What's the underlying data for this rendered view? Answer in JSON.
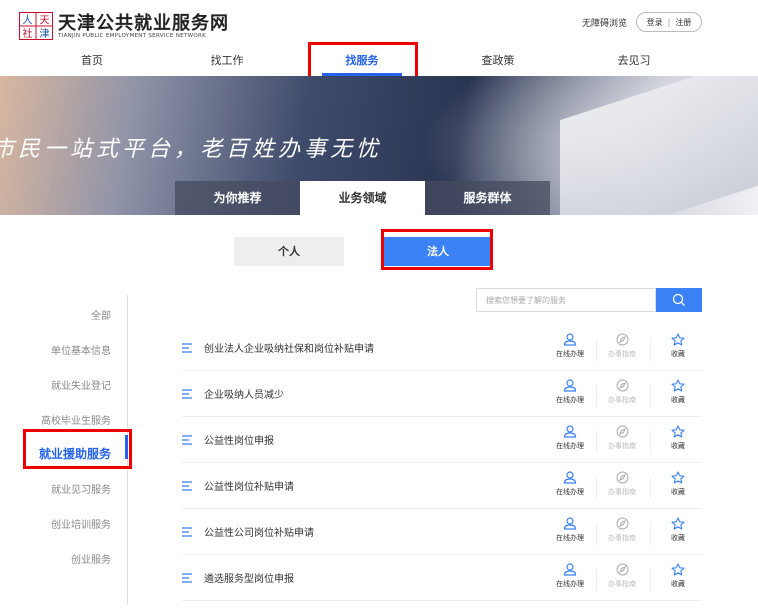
{
  "header": {
    "logo_mark_text": "人天社津",
    "title": "天津公共就业服务网",
    "subtitle": "TIANJIN PUBLIC EMPLOYMENT SERVICE NETWORK",
    "accessibility": "无障碍浏览",
    "login": "登录",
    "register": "注册"
  },
  "nav": [
    {
      "label": "首页",
      "active": false
    },
    {
      "label": "找工作",
      "active": false
    },
    {
      "label": "找服务",
      "active": true
    },
    {
      "label": "查政策",
      "active": false
    },
    {
      "label": "去见习",
      "active": false
    }
  ],
  "banner": {
    "slogan": "市民一站式平台，老百姓办事无忧",
    "tabs": [
      {
        "label": "为你推荐",
        "active": false
      },
      {
        "label": "业务领域",
        "active": true
      },
      {
        "label": "服务群体",
        "active": false
      }
    ]
  },
  "toggle": [
    {
      "label": "个人",
      "active": false
    },
    {
      "label": "法人",
      "active": true
    }
  ],
  "search": {
    "placeholder": "搜索您想要了解的服务"
  },
  "sidebar": [
    {
      "label": "全部",
      "active": false
    },
    {
      "label": "单位基本信息",
      "active": false
    },
    {
      "label": "就业失业登记",
      "active": false
    },
    {
      "label": "高校毕业生服务",
      "active": false
    },
    {
      "label": "就业援助服务",
      "active": true
    },
    {
      "label": "就业见习服务",
      "active": false
    },
    {
      "label": "创业培训服务",
      "active": false
    },
    {
      "label": "创业服务",
      "active": false
    }
  ],
  "actions": {
    "online": "在线办理",
    "guide": "办事指南",
    "fav": "收藏"
  },
  "services": [
    "创业法人企业吸纳社保和岗位补贴申请",
    "企业吸纳人员减少",
    "公益性岗位申报",
    "公益性岗位补贴申请",
    "公益性公司岗位补贴申请",
    "遴选服务型岗位申报"
  ],
  "colors": {
    "accent": "#2563eb",
    "button": "#3b82f6",
    "highlight": "#e00000"
  }
}
